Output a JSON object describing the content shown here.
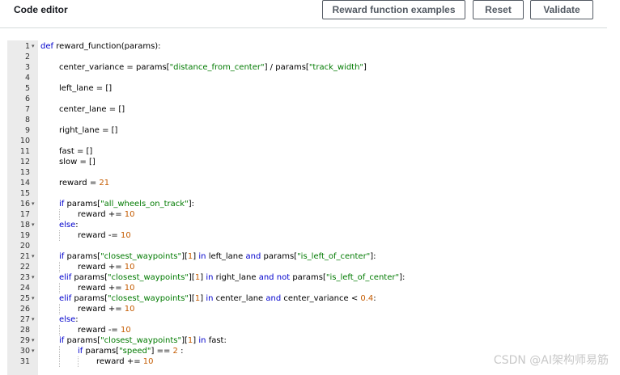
{
  "header": {
    "title": "Code editor",
    "buttons": {
      "examples": "Reward function examples",
      "reset": "Reset",
      "validate": "Validate"
    }
  },
  "editor": {
    "language": "python",
    "lines": [
      {
        "n": "1",
        "fold": true,
        "indent": 0,
        "code": "def reward_function(params):"
      },
      {
        "n": "2",
        "fold": false,
        "indent": 0,
        "code": ""
      },
      {
        "n": "3",
        "fold": false,
        "indent": 1,
        "code": "center_variance = params[\"distance_from_center\"] / params[\"track_width\"]"
      },
      {
        "n": "4",
        "fold": false,
        "indent": 0,
        "code": ""
      },
      {
        "n": "5",
        "fold": false,
        "indent": 1,
        "code": "left_lane = []"
      },
      {
        "n": "6",
        "fold": false,
        "indent": 0,
        "code": ""
      },
      {
        "n": "7",
        "fold": false,
        "indent": 1,
        "code": "center_lane = []"
      },
      {
        "n": "8",
        "fold": false,
        "indent": 0,
        "code": ""
      },
      {
        "n": "9",
        "fold": false,
        "indent": 1,
        "code": "right_lane = []"
      },
      {
        "n": "10",
        "fold": false,
        "indent": 0,
        "code": ""
      },
      {
        "n": "11",
        "fold": false,
        "indent": 1,
        "code": "fast = []"
      },
      {
        "n": "12",
        "fold": false,
        "indent": 1,
        "code": "slow = []"
      },
      {
        "n": "13",
        "fold": false,
        "indent": 0,
        "code": ""
      },
      {
        "n": "14",
        "fold": false,
        "indent": 1,
        "code": "reward = 21"
      },
      {
        "n": "15",
        "fold": false,
        "indent": 0,
        "code": ""
      },
      {
        "n": "16",
        "fold": true,
        "indent": 1,
        "code": "if params[\"all_wheels_on_track\"]:"
      },
      {
        "n": "17",
        "fold": false,
        "indent": 2,
        "code": "reward += 10"
      },
      {
        "n": "18",
        "fold": true,
        "indent": 1,
        "code": "else:"
      },
      {
        "n": "19",
        "fold": false,
        "indent": 2,
        "code": "reward -= 10"
      },
      {
        "n": "20",
        "fold": false,
        "indent": 0,
        "code": ""
      },
      {
        "n": "21",
        "fold": true,
        "indent": 1,
        "code": "if params[\"closest_waypoints\"][1] in left_lane and params[\"is_left_of_center\"]:"
      },
      {
        "n": "22",
        "fold": false,
        "indent": 2,
        "code": "reward += 10"
      },
      {
        "n": "23",
        "fold": true,
        "indent": 1,
        "code": "elif params[\"closest_waypoints\"][1] in right_lane and not params[\"is_left_of_center\"]:"
      },
      {
        "n": "24",
        "fold": false,
        "indent": 2,
        "code": "reward += 10"
      },
      {
        "n": "25",
        "fold": true,
        "indent": 1,
        "code": "elif params[\"closest_waypoints\"][1] in center_lane and center_variance < 0.4:"
      },
      {
        "n": "26",
        "fold": false,
        "indent": 2,
        "code": "reward += 10"
      },
      {
        "n": "27",
        "fold": true,
        "indent": 1,
        "code": "else:"
      },
      {
        "n": "28",
        "fold": false,
        "indent": 2,
        "code": "reward -= 10"
      },
      {
        "n": "29",
        "fold": true,
        "indent": 1,
        "code": "if params[\"closest_waypoints\"][1] in fast:"
      },
      {
        "n": "30",
        "fold": true,
        "indent": 2,
        "code": "if params[\"speed\"] == 2 :"
      },
      {
        "n": "31",
        "fold": false,
        "indent": 3,
        "code": "reward += 10"
      }
    ]
  },
  "watermark": "CSDN @AI架构师易筋",
  "colors": {
    "keyword": "#0000cc",
    "string": "#007a00",
    "number": "#c45b00",
    "gutter": "#ebebeb"
  }
}
